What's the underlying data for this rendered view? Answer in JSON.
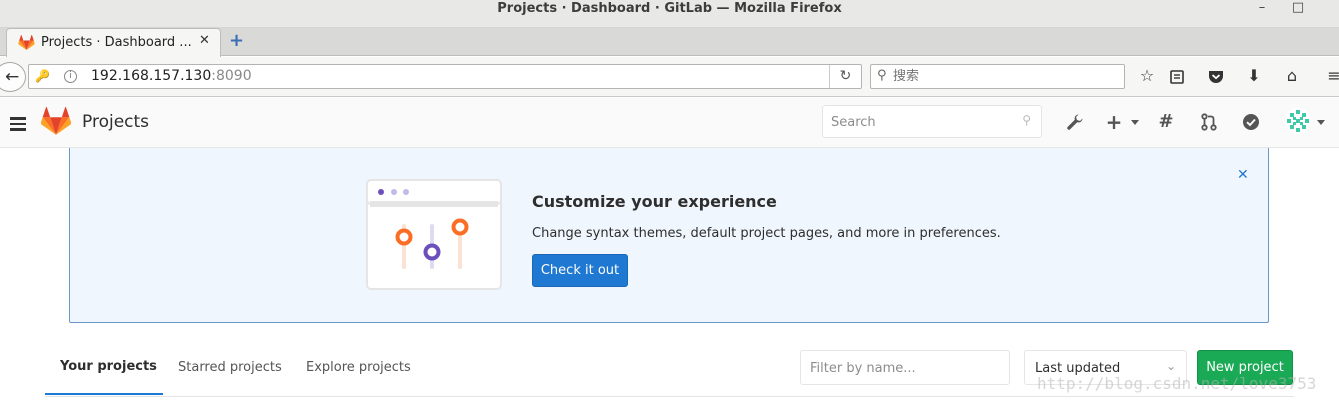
{
  "window": {
    "title": "Projects · Dashboard · GitLab — Mozilla Firefox",
    "minimize": "–",
    "maximize": "□"
  },
  "browser": {
    "tab_title": "Projects · Dashboard ...",
    "tab_close": "✕",
    "new_tab": "+",
    "url_host": "192.168.157.130",
    "url_port": ":8090",
    "search_placeholder": "搜索"
  },
  "header": {
    "title": "Projects",
    "search_placeholder": "Search"
  },
  "callout": {
    "heading": "Customize your experience",
    "description": "Change syntax themes, default project pages, and more in preferences.",
    "button": "Check it out",
    "dismiss": "✕"
  },
  "projects_nav": {
    "tabs": [
      {
        "label": "Your projects",
        "active": true
      },
      {
        "label": "Starred projects",
        "active": false
      },
      {
        "label": "Explore projects",
        "active": false
      }
    ],
    "filter_placeholder": "Filter by name...",
    "sort_value": "Last updated",
    "new_project": "New project"
  },
  "watermark": "http://blog.csdn.net/love3753",
  "colors": {
    "primary": "#1f78d1",
    "success": "#1aaa55",
    "callout_bg": "#f0f6fd",
    "gitlab_orange": "#fc6d26",
    "gitlab_purple": "#6b4fbb"
  }
}
